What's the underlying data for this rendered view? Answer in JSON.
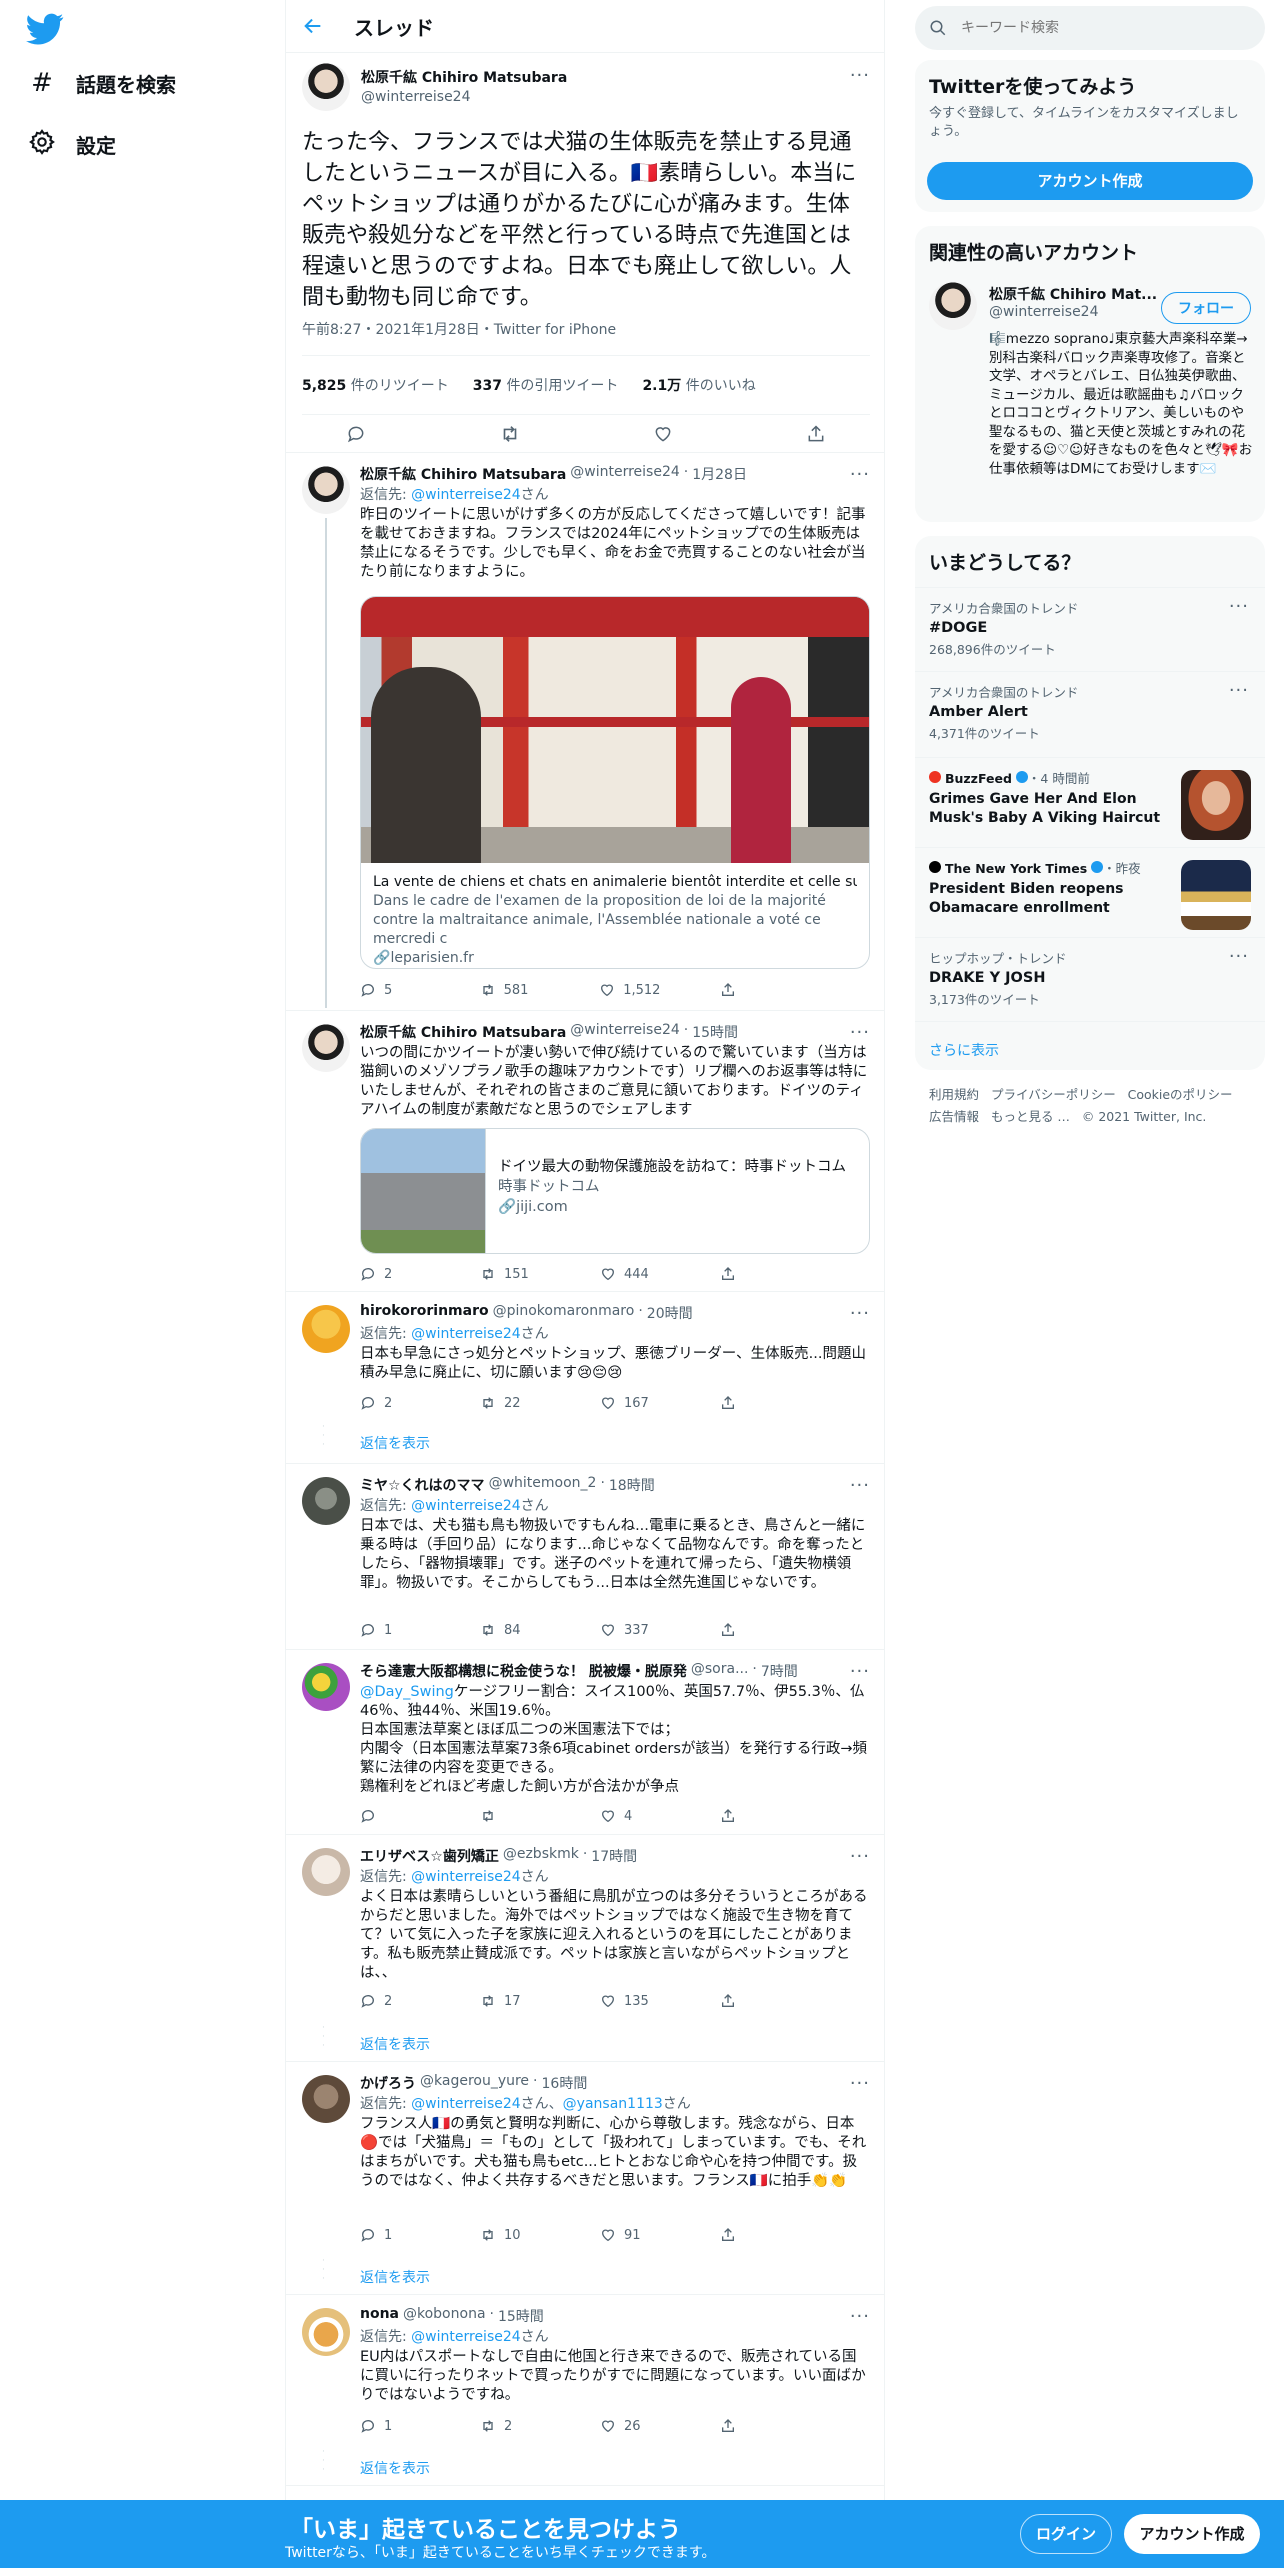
{
  "nav": {
    "explore": "話題を検索",
    "settings": "設定"
  },
  "header": {
    "title": "スレッド"
  },
  "main_tweet": {
    "name": "松原千紘 Chihiro Matsubara",
    "handle": "@winterreise24",
    "text": "たった今、フランスでは犬猫の生体販売を禁止する見通したというニュースが目に入る。🇫🇷素晴らしい。本当にペットショップは通りがかるたびに心が痛みます。生体販売や殺処分などを平然と行っている時点で先進国とは程遠いと思うのですよね。日本でも廃止して欲しい。人間も動物も同じ命です。",
    "meta": "午前8:27・2021年1月28日・Twitter for iPhone",
    "retweets_num": "5,825",
    "retweets_label": "件のリツイート",
    "quotes_num": "337",
    "quotes_label": "件の引用ツイート",
    "likes_num": "2.1万",
    "likes_label": "件のいいね"
  },
  "reply_prefix": "返信先:",
  "reply_suffix": "さん",
  "show_replies": "返信を表示",
  "tweets": [
    {
      "name": "松原千紘 Chihiro Matsubara",
      "handle": "@winterreise24",
      "time": "1月28日",
      "reply_to": "@winterreise24",
      "text": "昨日のツイートに思いがけず多くの方が反応してくださって嬉しいです！記事を載せておきますね。フランスでは2024年にペットショップでの生体販売は禁止になるそうです。少しでも早く、命をお金で売買することのない社会が当たり前になりますように。",
      "card_title": "La vente de chiens et chats en animalerie bientôt interdite et celle sur I…",
      "card_desc": "Dans le cadre de l'examen de la proposition de loi de la majorité contre la maltraitance animale, l'Assemblée nationale a voté ce mercredi c",
      "card_domain": "leparisien.fr",
      "replies": "5",
      "retweets": "581",
      "likes": "1,512"
    },
    {
      "name": "松原千紘 Chihiro Matsubara",
      "handle": "@winterreise24",
      "time": "15時間",
      "text": "いつの間にかツイートが凄い勢いで伸び続けているので驚いています（当方は猫飼いのメゾソプラノ歌手の趣味アカウントです）リプ欄へのお返事等は特にいたしませんが、それぞれの皆さまのご意見に頷いております。ドイツのティアハイムの制度が素敵だなと思うのでシェアします",
      "card_title": "ドイツ最大の動物保護施設を訪ねて：時事ドットコム",
      "card_desc": "時事ドットコム",
      "card_domain": "jiji.com",
      "replies": "2",
      "retweets": "151",
      "likes": "444"
    },
    {
      "name": "hirokororinmaro",
      "handle": "@pinokomaronmaro",
      "time": "20時間",
      "reply_to": "@winterreise24",
      "text": "日本も早急にさっ処分とペットショップ、悪徳ブリーダー、生体販売...問題山積み早急に廃止に、切に願います😢😔😢",
      "replies": "2",
      "retweets": "22",
      "likes": "167"
    },
    {
      "name": "ミヤ☆くれはのママ",
      "handle": "@whitemoon_2",
      "time": "18時間",
      "reply_to": "@winterreise24",
      "text": "日本では、犬も猫も鳥も物扱いですもんね...電車に乗るとき、鳥さんと一緒に乗る時は（手回り品）になります...命じゃなくて品物なんです。命を奪ったとしたら、「器物損壊罪」です。迷子のペットを連れて帰ったら、「遺失物横領罪」。物扱いです。そこからしてもう...日本は全然先進国じゃないです。",
      "replies": "1",
      "retweets": "84",
      "likes": "337"
    },
    {
      "name": "そら達憲大阪都構想に税金使うな！ 脱被爆・脱原発",
      "handle": "@sora...",
      "time": "7時間",
      "mention": "@Day_Swing",
      "text": "ケージフリー割合：スイス100％、英国57.7％、伊55.3％、仏46％、独44％、米国19.6％。\n日本国憲法草案とほぼ瓜二つの米国憲法下では；\n内閣令（日本国憲法草案73条6項cabinet ordersが該当）を発行する行政→頻繁に法律の内容を変更できる。\n鶏権利をどれほど考慮した飼い方が合法かが争点",
      "replies": "",
      "retweets": "",
      "likes": "4"
    },
    {
      "name": "エリザベス☆歯列矯正",
      "handle": "@ezbskmk",
      "time": "17時間",
      "reply_to": "@winterreise24",
      "text": "よく日本は素晴らしいという番組に鳥肌が立つのは多分そういうところがあるからだと思いました。海外ではペットショップではなく施設で生き物を育てて？いて気に入った子を家族に迎え入れるというのを耳にしたことがあります。私も販売禁止賛成派です。ペットは家族と言いながらペットショップとは、、",
      "replies": "2",
      "retweets": "17",
      "likes": "135"
    },
    {
      "name": "かげろう",
      "handle": "@kagerou_yure",
      "time": "16時間",
      "reply_to": "@winterreise24",
      "reply_to2": "@yansan1113",
      "text": "フランス人🇫🇷の勇気と賢明な判断に、心から尊敬します。残念ながら、日本🔴では「犬猫鳥」＝「もの」として「扱われて」しまっています。でも、それはまちがいです。犬も猫も鳥もetc...ヒトとおなじ命や心を持つ仲間です。扱うのではなく、仲よく共存するべきだと思います。フランス🇫🇷に拍手👏👏",
      "replies": "1",
      "retweets": "10",
      "likes": "91"
    },
    {
      "name": "nona",
      "handle": "@kobonona",
      "time": "15時間",
      "reply_to": "@winterreise24",
      "text": "EU内はパスポートなしで自由に他国と行き来できるので、販売されている国に買いに行ったりネットで買ったりがすでに問題になっています。いい面ばかりではないようですね。",
      "replies": "1",
      "retweets": "2",
      "likes": "26"
    }
  ],
  "search": {
    "placeholder": "キーワード検索"
  },
  "signup_box": {
    "title": "Twitterを使ってみよう",
    "desc": "今すぐ登録して、タイムラインをカスタマイズしましょう。",
    "button": "アカウント作成"
  },
  "relevant": {
    "title": "関連性の高いアカウント",
    "name": "松原千紘 Chihiro Mat...",
    "handle": "@winterreise24",
    "follow": "フォロー",
    "bio": "🎼mezzo soprano♩東京藝大声楽科卒業→別科古楽科バロック声楽専攻修了。音楽と文学、オペラとバレエ、日仏独英伊歌曲、ミュージカル、最近は歌謡曲も♫バロックとロココとヴィクトリアン、美しいものや聖なるもの、猫と天使と茨城とすみれの花を愛する☺︎♡☺︎好きなものを色々と🕊🎀お仕事依頼等はDMにてお受けします✉️"
  },
  "trends": {
    "title": "いまどうしてる？",
    "items": [
      {
        "meta": "アメリカ合衆国のトレンド",
        "name": "#DOGE",
        "count": "268,896件のツイート"
      },
      {
        "meta": "アメリカ合衆国のトレンド",
        "name": "Amber Alert",
        "count": "4,371件のツイート"
      },
      {
        "source": "BuzzFeed",
        "time": "・4 時間前",
        "name": "Grimes Gave Her And Elon Musk's Baby A Viking Haircut"
      },
      {
        "source": "The New York Times",
        "time": "・昨夜",
        "name": "President Biden reopens Obamacare enrollment"
      },
      {
        "meta": "ヒップホップ・トレンド",
        "name": "DRAKE Y JOSH",
        "count": "3,173件のツイート"
      }
    ],
    "show_more": "さらに表示"
  },
  "footer": {
    "links": [
      "利用規約",
      "プライバシーポリシー",
      "Cookieのポリシー",
      "広告情報",
      "もっと見る …"
    ],
    "copyright": "© 2021 Twitter, Inc."
  },
  "bottom_bar": {
    "title": "「いま」起きていることを見つけよう",
    "subtitle": "Twitterなら、「いま」起きていることをいち早くチェックできます。",
    "login": "ログイン",
    "signup": "アカウント作成"
  },
  "colors": {
    "accent": "#1d9bf0",
    "text": "#0f1419",
    "secondary": "#536471"
  }
}
